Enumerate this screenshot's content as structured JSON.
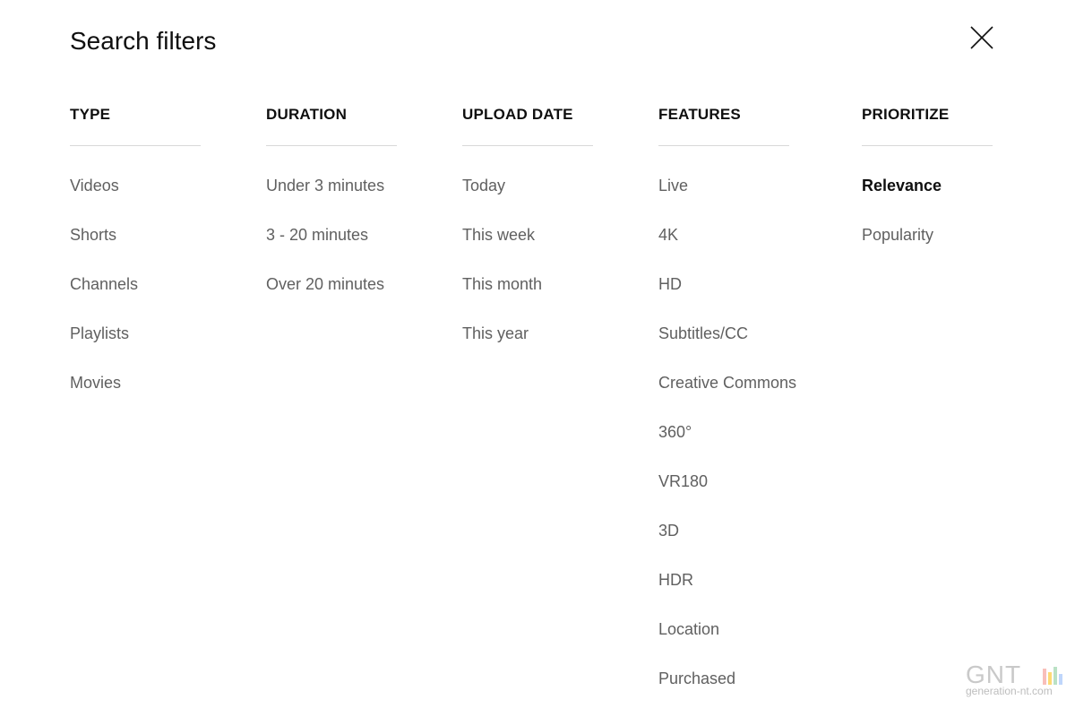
{
  "dialog": {
    "title": "Search filters",
    "close_icon": "close-icon"
  },
  "groups": [
    {
      "header": "TYPE",
      "options": [
        {
          "label": "Videos",
          "selected": false
        },
        {
          "label": "Shorts",
          "selected": false
        },
        {
          "label": "Channels",
          "selected": false
        },
        {
          "label": "Playlists",
          "selected": false
        },
        {
          "label": "Movies",
          "selected": false
        }
      ]
    },
    {
      "header": "DURATION",
      "options": [
        {
          "label": "Under 3 minutes",
          "selected": false
        },
        {
          "label": "3 - 20 minutes",
          "selected": false
        },
        {
          "label": "Over 20 minutes",
          "selected": false
        }
      ]
    },
    {
      "header": "UPLOAD DATE",
      "options": [
        {
          "label": "Today",
          "selected": false
        },
        {
          "label": "This week",
          "selected": false
        },
        {
          "label": "This month",
          "selected": false
        },
        {
          "label": "This year",
          "selected": false
        }
      ]
    },
    {
      "header": "FEATURES",
      "options": [
        {
          "label": "Live",
          "selected": false
        },
        {
          "label": "4K",
          "selected": false
        },
        {
          "label": "HD",
          "selected": false
        },
        {
          "label": "Subtitles/CC",
          "selected": false
        },
        {
          "label": "Creative Commons",
          "selected": false
        },
        {
          "label": "360°",
          "selected": false
        },
        {
          "label": "VR180",
          "selected": false
        },
        {
          "label": "3D",
          "selected": false
        },
        {
          "label": "HDR",
          "selected": false
        },
        {
          "label": "Location",
          "selected": false
        },
        {
          "label": "Purchased",
          "selected": false
        }
      ]
    },
    {
      "header": "PRIORITIZE",
      "options": [
        {
          "label": "Relevance",
          "selected": true
        },
        {
          "label": "Popularity",
          "selected": false
        }
      ]
    }
  ],
  "watermark": {
    "logo_text": "GNT",
    "url": "generation-nt.com",
    "bar_colors": [
      "#f28b82",
      "#fbbc04",
      "#81c995",
      "#8ab4f8"
    ]
  },
  "colors": {
    "text_primary": "#0f0f0f",
    "text_secondary": "#606060",
    "divider": "#d9d9d9"
  }
}
